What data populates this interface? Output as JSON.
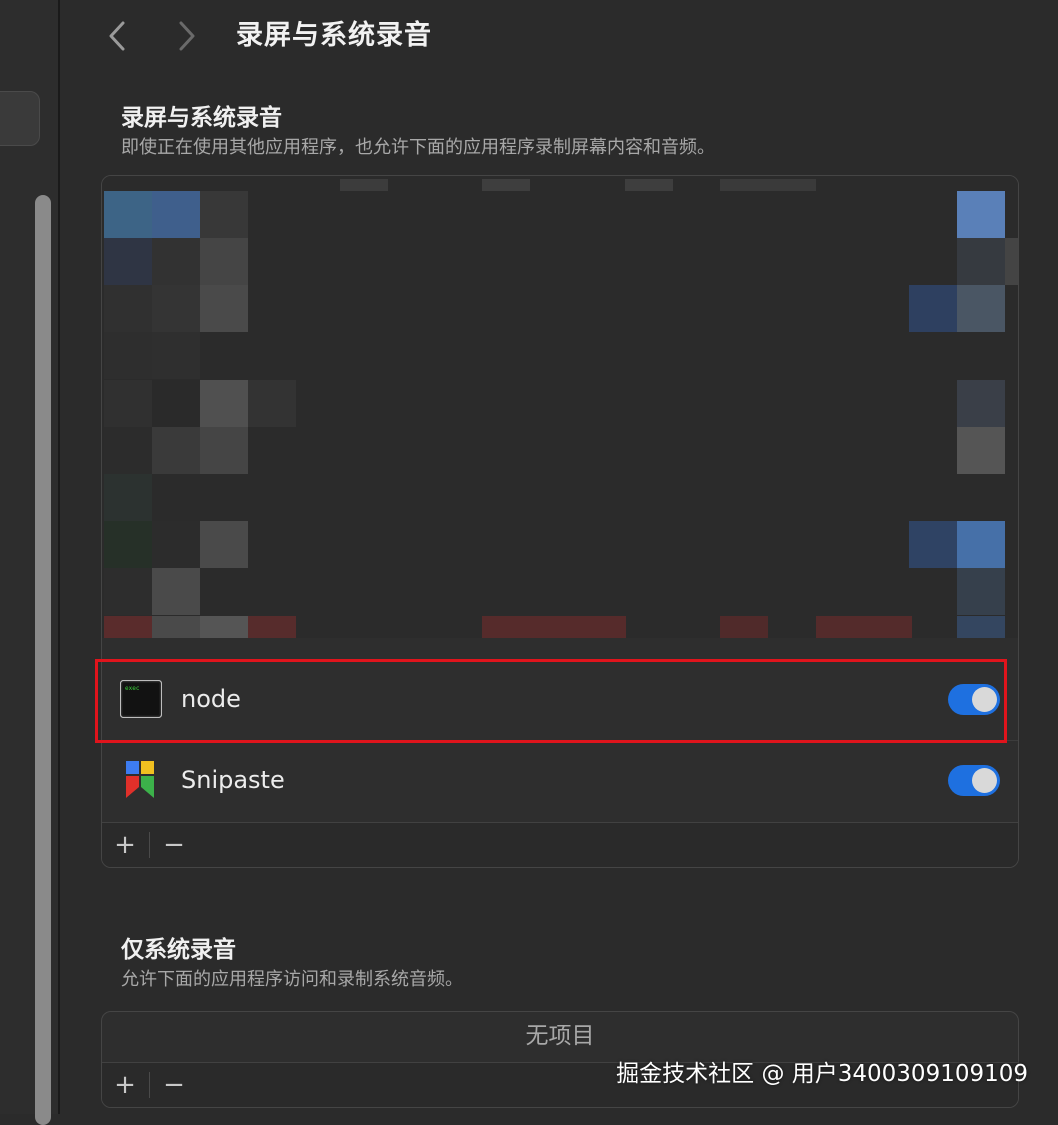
{
  "window": {
    "title": "录屏与系统录音"
  },
  "nav": {
    "back_icon": "chevron-left-icon",
    "forward_icon": "chevron-right-icon"
  },
  "screen_recording": {
    "title": "录屏与系统录音",
    "description": "即使正在使用其他应用程序，也允许下面的应用程序录制屏幕内容和音频。",
    "apps": [
      {
        "name": "node",
        "icon": "terminal-exec-icon",
        "enabled": true,
        "highlighted": true
      },
      {
        "name": "Snipaste",
        "icon": "snipaste-icon",
        "enabled": true,
        "highlighted": false
      }
    ],
    "add_label": "+",
    "remove_label": "−"
  },
  "system_audio": {
    "title": "仅系统录音",
    "description": "允许下面的应用程序访问和录制系统音频。",
    "empty_text": "无项目",
    "add_label": "+",
    "remove_label": "−"
  },
  "watermark": "掘金技术社区 @ 用户3400309109109",
  "colors": {
    "toggle_on": "#1e70e0",
    "highlight": "#e0141c",
    "background": "#2b2b2b"
  }
}
